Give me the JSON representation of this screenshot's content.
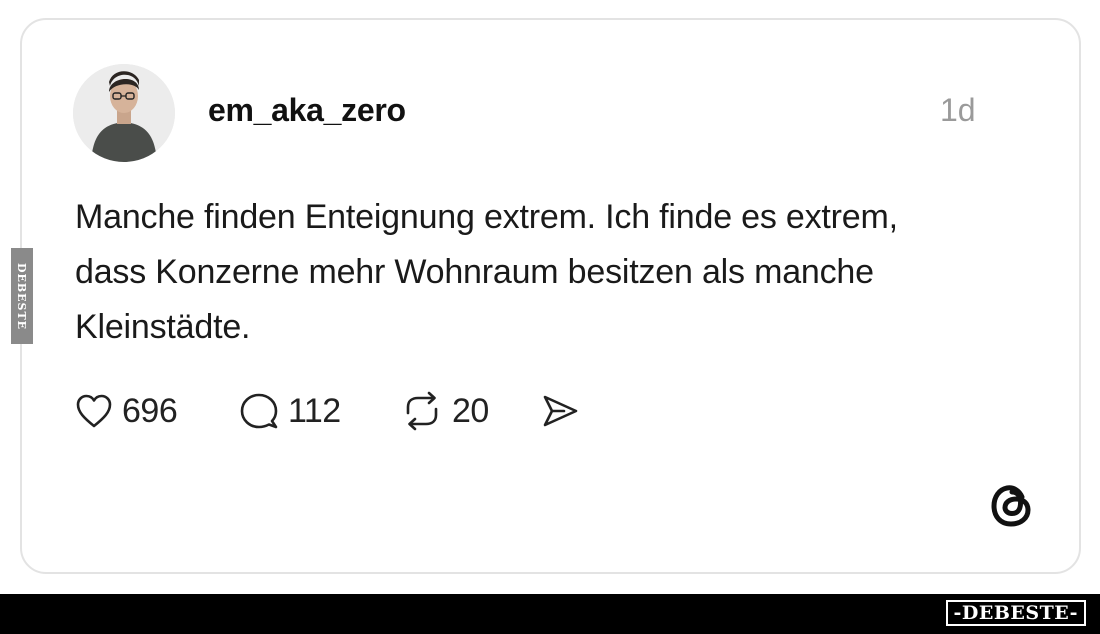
{
  "post": {
    "username": "em_aka_zero",
    "time": "1d",
    "text": "Manche finden Enteignung extrem. Ich finde es extrem, dass Konzerne mehr Wohnraum besitzen als manche Kleinstädte.",
    "likes": "696",
    "comments": "112",
    "reposts": "20"
  },
  "icons": {
    "like": "heart-icon",
    "comment": "speech-bubble-icon",
    "repost": "repost-icon",
    "share": "send-icon",
    "app": "threads-logo"
  },
  "watermark": {
    "side": "DEBESTE",
    "brand": "-DEBESTE-"
  }
}
